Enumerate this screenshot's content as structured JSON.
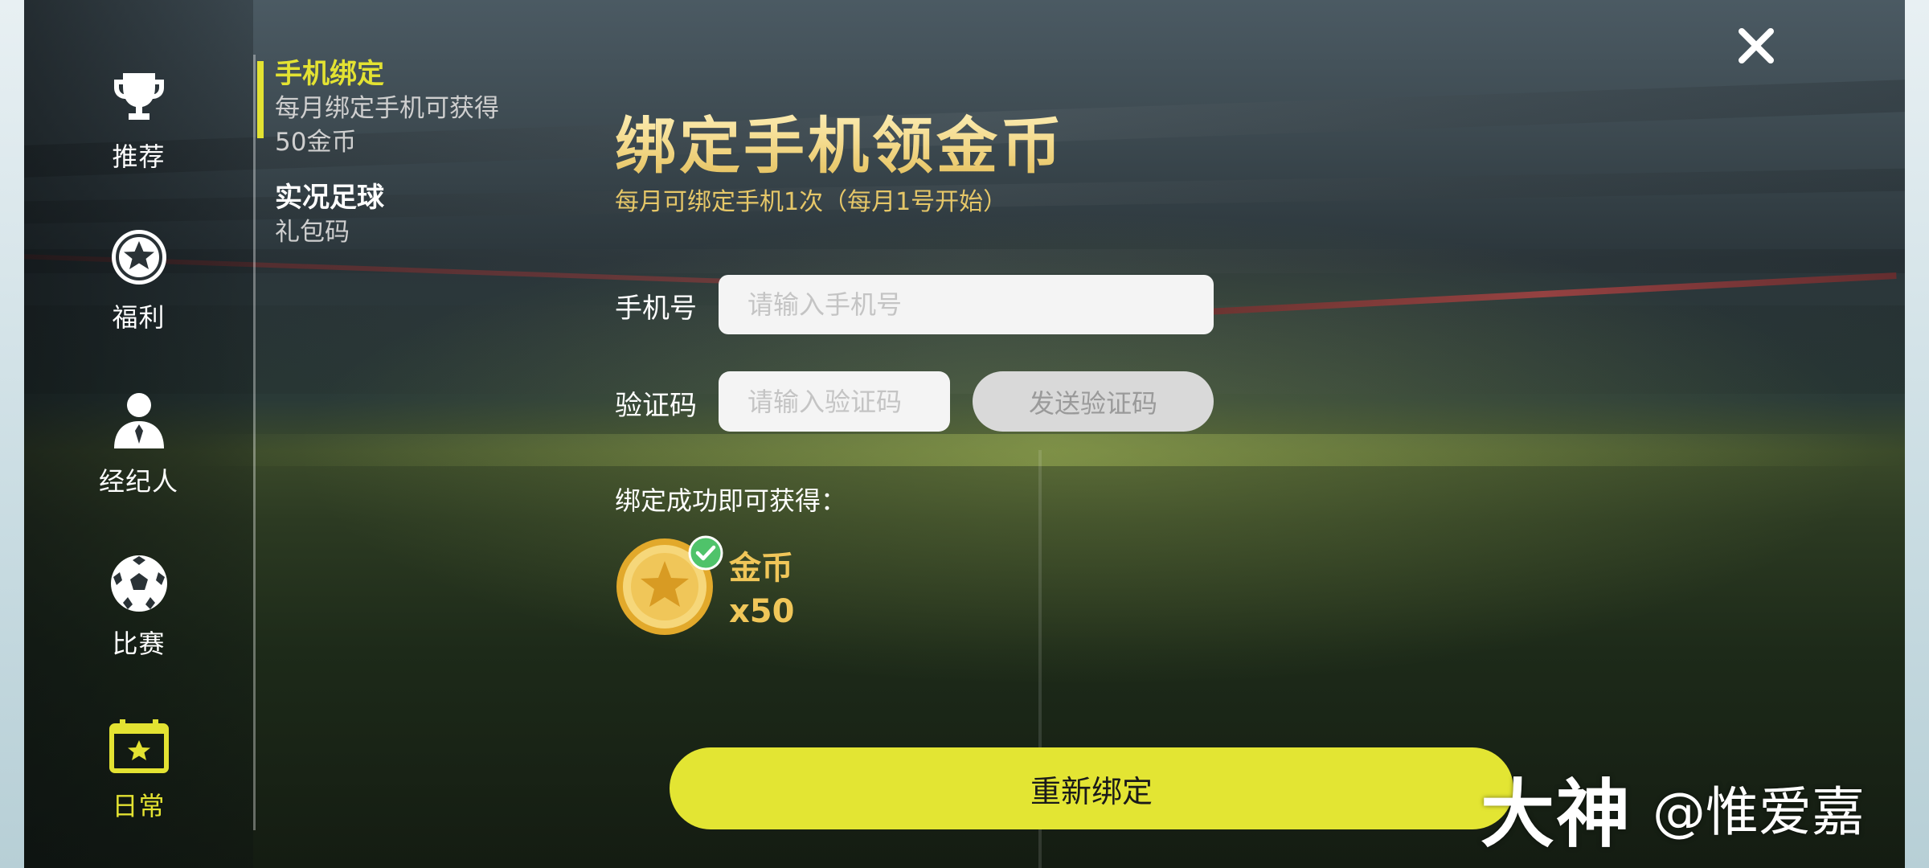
{
  "nav": {
    "items": [
      {
        "label": "推荐",
        "icon": "trophy-icon",
        "active": false
      },
      {
        "label": "福利",
        "icon": "star-badge-icon",
        "active": false
      },
      {
        "label": "经纪人",
        "icon": "agent-icon",
        "active": false
      },
      {
        "label": "比赛",
        "icon": "soccer-ball-icon",
        "active": false
      },
      {
        "label": "日常",
        "icon": "calendar-star-icon",
        "active": true
      }
    ]
  },
  "submenu": {
    "items": [
      {
        "title": "手机绑定",
        "desc": "每月绑定手机可获得50金币",
        "active": true
      },
      {
        "title": "实况足球",
        "desc": "礼包码",
        "active": false
      }
    ]
  },
  "main": {
    "title": "绑定手机领金币",
    "subtitle": "每月可绑定手机1次（每月1号开始）",
    "phone_label": "手机号",
    "phone_placeholder": "请输入手机号",
    "code_label": "验证码",
    "code_placeholder": "请输入验证码",
    "send_code_label": "发送验证码",
    "reward_label": "绑定成功即可获得：",
    "reward_name": "金币",
    "reward_qty": "x50",
    "rebind_label": "重新绑定"
  },
  "watermark": {
    "brand": "大神",
    "user": "@惟爱嘉"
  },
  "colors": {
    "accent_yellow": "#e3e232",
    "gold": "#f0c659",
    "check_green": "#4fc36a"
  }
}
